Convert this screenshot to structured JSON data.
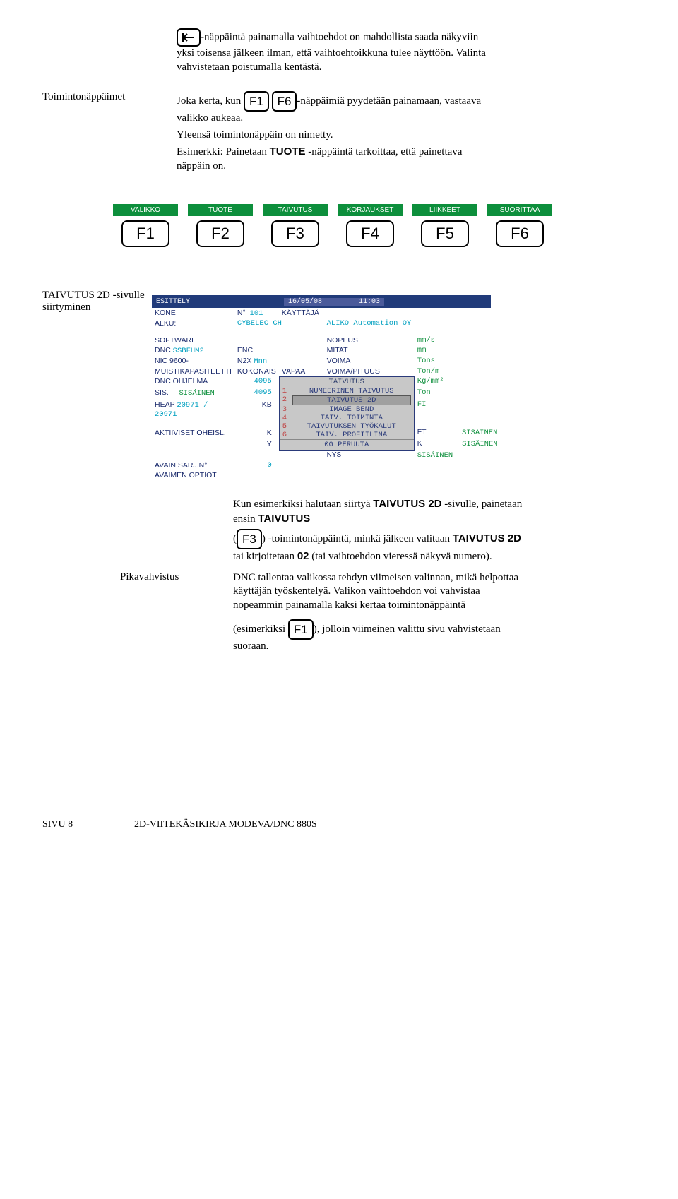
{
  "section1": {
    "para1_a": "-näppäintä painamalla vaihtoehdot on mahdollista saada näkyviin yksi toisensa jälkeen ilman, että vaihtoehtoikkuna tulee näyttöön. Valinta vahvistetaan poistumalla kentästä."
  },
  "section2": {
    "label": "Toimintonäppäimet",
    "key1": "F1",
    "key6": "F6",
    "p1a": "Joka kerta, kun ",
    "p1b": "-näppäimiä pyydetään painamaan, vastaava valikko aukeaa.",
    "p2": "Yleensä toimintonäppäin on nimetty.",
    "p3": "Esimerkki: Painetaan ",
    "p3b": " -näppäintä tarkoittaa, että painettava näppäin on.",
    "tuote": "TUOTE"
  },
  "greentabs": [
    "VALIKKO",
    "TUOTE",
    "TAIVUTUS",
    "KORJAUKSET",
    "LIIKKEET",
    "SUORITTAA"
  ],
  "fkeys": [
    "F1",
    "F2",
    "F3",
    "F4",
    "F5",
    "F6"
  ],
  "section3": {
    "label": "TAIVUTUS 2D -sivulle siirtyminen"
  },
  "screenshot": {
    "hdr_left": "ESITTELY",
    "hdr_date": "16/05/08",
    "hdr_time": "11:03",
    "rows": {
      "kone": "KONE",
      "kone_n": "N°",
      "kone_v": "101",
      "kayttaja": "KÄYTTÄJÄ",
      "alku": "ALKU:",
      "alku_v": "CYBELEC CH",
      "aliko": "ALIKO Automation OY",
      "software": "SOFTWARE",
      "nopeus": "NOPEUS",
      "nopeus_u": "mm/s",
      "dnc": "DNC",
      "dnc_v": "SSBFHM2",
      "enc": "ENC",
      "mitat": "MITAT",
      "mitat_u": "mm",
      "nic": "NIC 9600-",
      "n2x": "N2X",
      "n2x_v": "Mnn",
      "voima": "VOIMA",
      "voima_u": "Tons",
      "muisti": "MUISTIKAPASITEETTI",
      "kokonais": "KOKONAIS",
      "vapaa": "VAPAA",
      "voimapituus": "VOIMA/PITUUS",
      "voimapituus_u": "Ton/m",
      "dncohj": "DNC OHJELMA",
      "dncohj_v": "4095",
      "kg": "Kg/mm²",
      "sis": "SIS.",
      "sis_v": "SISÄINEN",
      "sis_n": "4095",
      "ton": "Ton",
      "heap": "HEAP",
      "heap_v": "20971 / 20971",
      "kb": "KB",
      "fi": "FI",
      "akt": "AKTIIVISET OHEISL.",
      "et": "ET",
      "k_cell": "K",
      "y_cell": "Y",
      "k_v": "K",
      "k_r": "SISÄINEN",
      "nys": "NYS",
      "avain": "AVAIN SARJ.N°",
      "avain_v": "0",
      "avaimen": "AVAIMEN OPTIOT"
    },
    "popup": {
      "title": "TAIVUTUS",
      "opts": [
        {
          "n": "1",
          "t": "NUMEERINEN TAIVUTUS"
        },
        {
          "n": "2",
          "t": "TAIVUTUS 2D"
        },
        {
          "n": "3",
          "t": "IMAGE BEND"
        },
        {
          "n": "4",
          "t": "TAIV. TOIMINTA"
        },
        {
          "n": "5",
          "t": "TAIVUTUKSEN TYÖKALUT"
        },
        {
          "n": "6",
          "t": "TAIV. PROFIILINA"
        }
      ],
      "footer": "00 PERUUTA"
    }
  },
  "section4": {
    "p1a": "Kun esimerkiksi halutaan siirtyä ",
    "p1b": " -sivulle, painetaan ensin ",
    "taiv2d": "TAIVUTUS 2D",
    "taiv": "TAIVUTUS",
    "p2a": "(",
    "p2b": ") -toimintonäppäintä, minkä jälkeen valitaan ",
    "p2c": " tai kirjoitetaan ",
    "p2d": " (tai vaihtoehdon vieressä näkyvä numero).",
    "zero2": "02",
    "f3": "F3"
  },
  "section5": {
    "label": "Pikavahvistus",
    "p1": "DNC tallentaa valikossa tehdyn viimeisen valinnan, mikä helpottaa käyttäjän työskentelyä. Valikon vaihtoehdon voi vahvistaa nopeammin painamalla kaksi kertaa toimintonäppäintä",
    "p2a": "(esimerkiksi ",
    "p2b": "), jolloin viimeinen valittu sivu vahvistetaan suoraan.",
    "f1": "F1"
  },
  "footer": {
    "left": "SIVU 8",
    "right": "2D-VIITEKÄSIKIRJA MODEVA/DNC 880S"
  }
}
